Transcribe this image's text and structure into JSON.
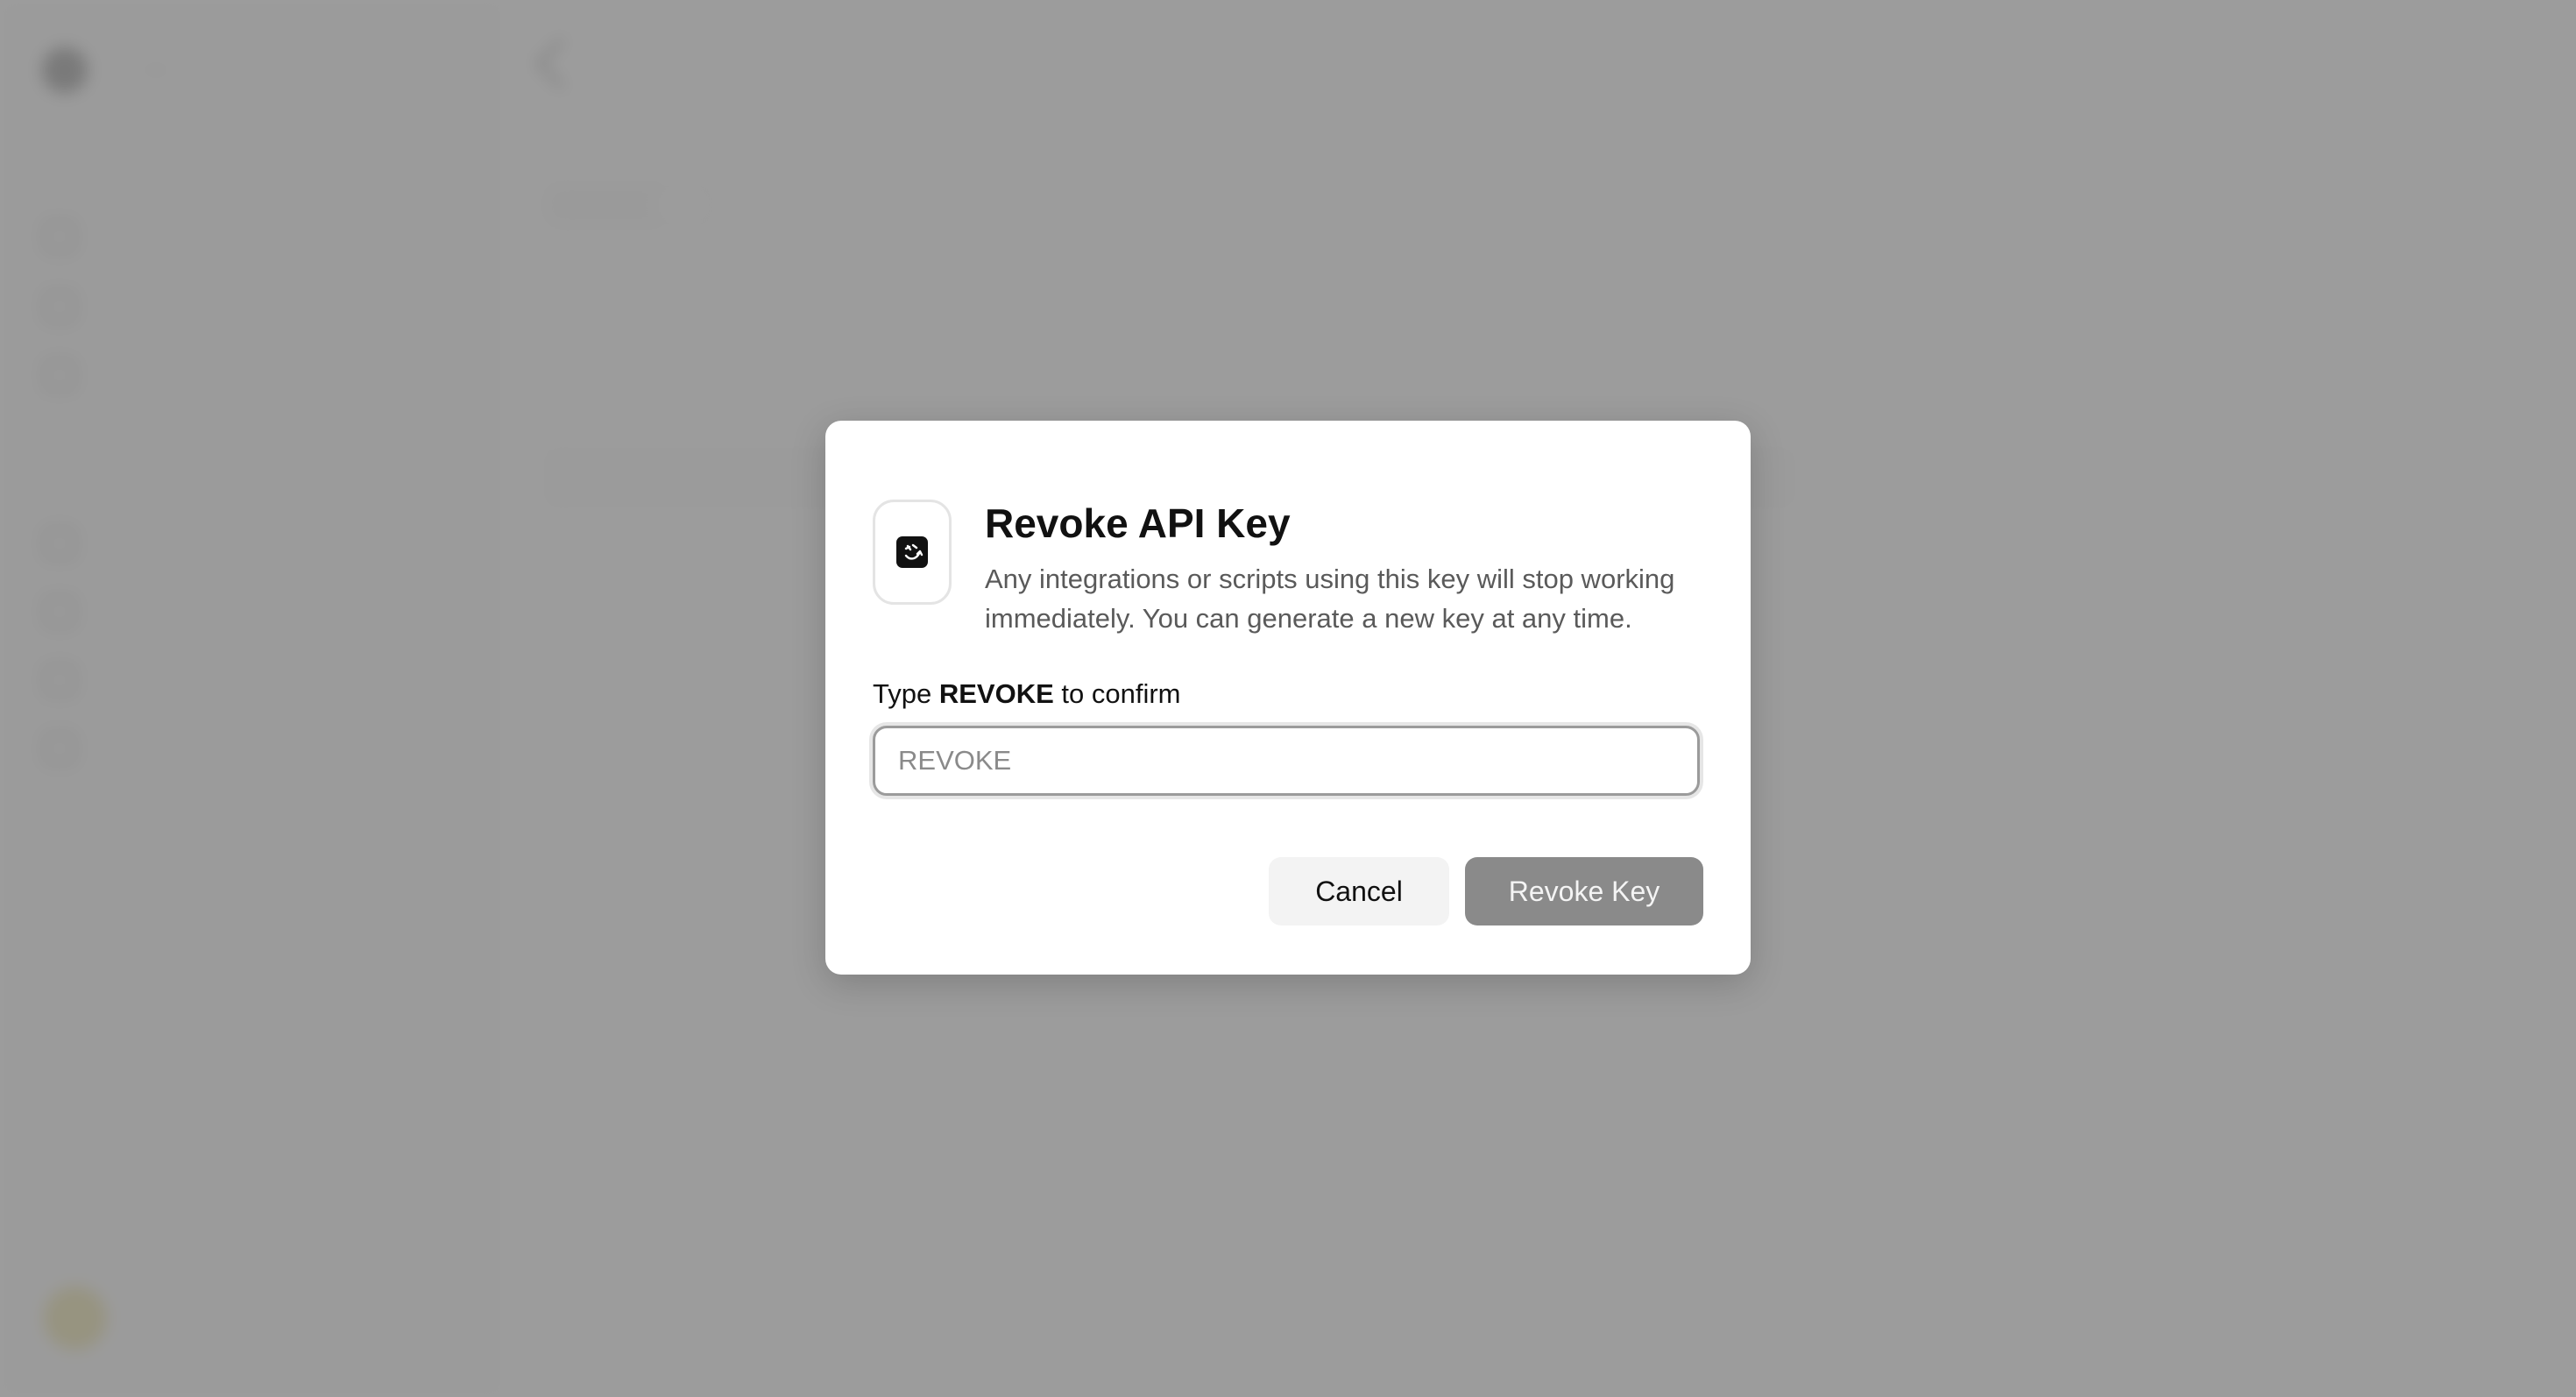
{
  "background": {
    "brand": {
      "name": "",
      "badge": ""
    },
    "sidebar": {
      "section_main": "",
      "items_main": [
        "",
        "",
        ""
      ],
      "section_secondary": "",
      "items_secondary": [
        "",
        "",
        "",
        ""
      ]
    },
    "user": {
      "name": "",
      "email": ""
    },
    "page": {
      "title": "",
      "subtitle": "",
      "tabs": [
        "",
        "",
        ""
      ],
      "section_title": "",
      "section_subtitle": "",
      "rows": [
        "",
        "",
        ""
      ],
      "note": ""
    }
  },
  "modal": {
    "icon": "key-icon",
    "title": "Revoke API Key",
    "description": "Any integrations or scripts using this key will stop working immediately. You can generate a new key at any time.",
    "confirm_prefix": "Type",
    "confirm_keyword": "REVOKE",
    "confirm_suffix": "to confirm",
    "input_placeholder": "REVOKE",
    "input_value": "",
    "cancel_label": "Cancel",
    "revoke_label": "Revoke Key"
  },
  "colors": {
    "overlay": "#8c8c8c",
    "modal_bg": "#ffffff",
    "revoke_disabled": "#8a8a8a",
    "cancel_bg": "#f3f3f3"
  }
}
